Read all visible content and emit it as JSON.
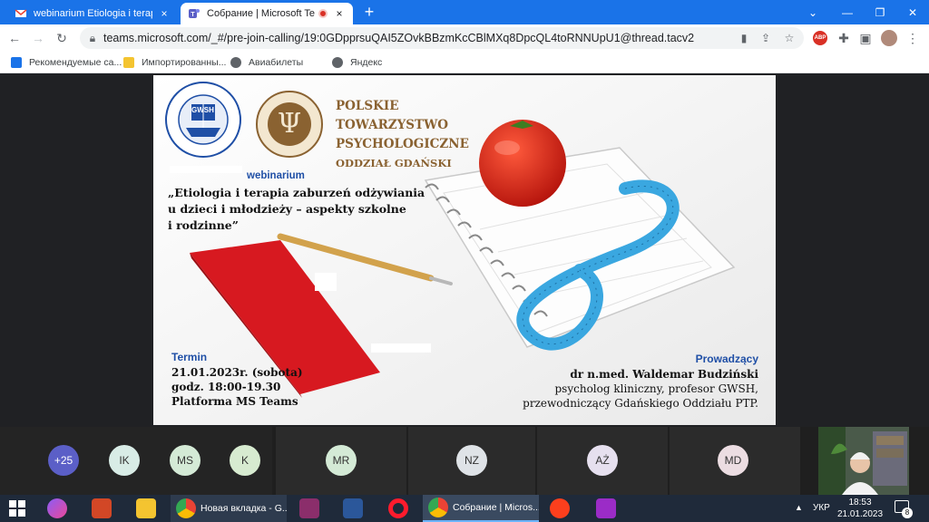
{
  "browser": {
    "tabs": [
      {
        "title": "webinarium Etiologia i terapia za",
        "close": "×",
        "active": false
      },
      {
        "title": "Собрание | Microsoft Teams",
        "close": "×",
        "active": true
      }
    ],
    "new_tab": "+",
    "window": {
      "minimize": "—",
      "restore": "❐",
      "close": "✕"
    },
    "url": "teams.microsoft.com/_#/pre-join-calling/19:0GDpprsuQAI5ZOvkBBzmKcCBlMXq8DpcQL4toRNNUpU1@thread.tacv2",
    "extension_badge": "ABP",
    "bookmarks": [
      "Рекомендуемые са...",
      "Импортированны...",
      "Авиабилеты",
      "Яндекс"
    ]
  },
  "slide": {
    "logo_left": "GWSH",
    "org": [
      "POLSKIE",
      "TOWARZYSTWO",
      "PSYCHOLOGICZNE",
      "ODDZIAŁ GDAŃSKI"
    ],
    "webinar_label": "webinarium",
    "title_lines": [
      "„Etiologia i terapia zaburzeń odżywiania",
      "u dzieci i młodzieży – aspekty szkolne",
      "i rodzinne”"
    ],
    "term_label": "Termin",
    "term_lines": [
      "21.01.2023r. (sobota)",
      "godz. 18:00-19.30",
      "Platforma MS Teams"
    ],
    "host_label": "Prowadzący",
    "host_lines": [
      "dr n.med. Waldemar Budziński",
      "psycholog kliniczny, profesor GWSH,",
      "przewodniczący Gdańskiego Oddziału PTP."
    ]
  },
  "participants": [
    {
      "initials": "+25",
      "color": "#5b5fc7",
      "text_color": "#ffffff"
    },
    {
      "initials": "IK",
      "color": "#d8ece6",
      "text_color": "#333333"
    },
    {
      "initials": "MS",
      "color": "#d4ead6",
      "text_color": "#333333"
    },
    {
      "initials": "K",
      "color": "#d7ebd0",
      "text_color": "#333333"
    },
    {
      "initials": "MR",
      "color": "#d4ead6",
      "text_color": "#333333"
    },
    {
      "initials": "NZ",
      "color": "#dfe3e7",
      "text_color": "#333333"
    },
    {
      "initials": "AŻ",
      "color": "#e6e0ef",
      "text_color": "#333333"
    },
    {
      "initials": "MD",
      "color": "#ecdde2",
      "text_color": "#333333"
    }
  ],
  "taskbar": {
    "tasks": [
      "Новая вкладка - G...",
      "Собрание | Micros..."
    ],
    "lang": "УКР",
    "time": "18:53",
    "date": "21.01.2023",
    "notifications": "8"
  },
  "colors": {
    "accent": "#1a73e8",
    "slide_blue": "#1f4fa6",
    "slide_brown": "#8a6231",
    "taskbar": "#1f2a3a"
  }
}
